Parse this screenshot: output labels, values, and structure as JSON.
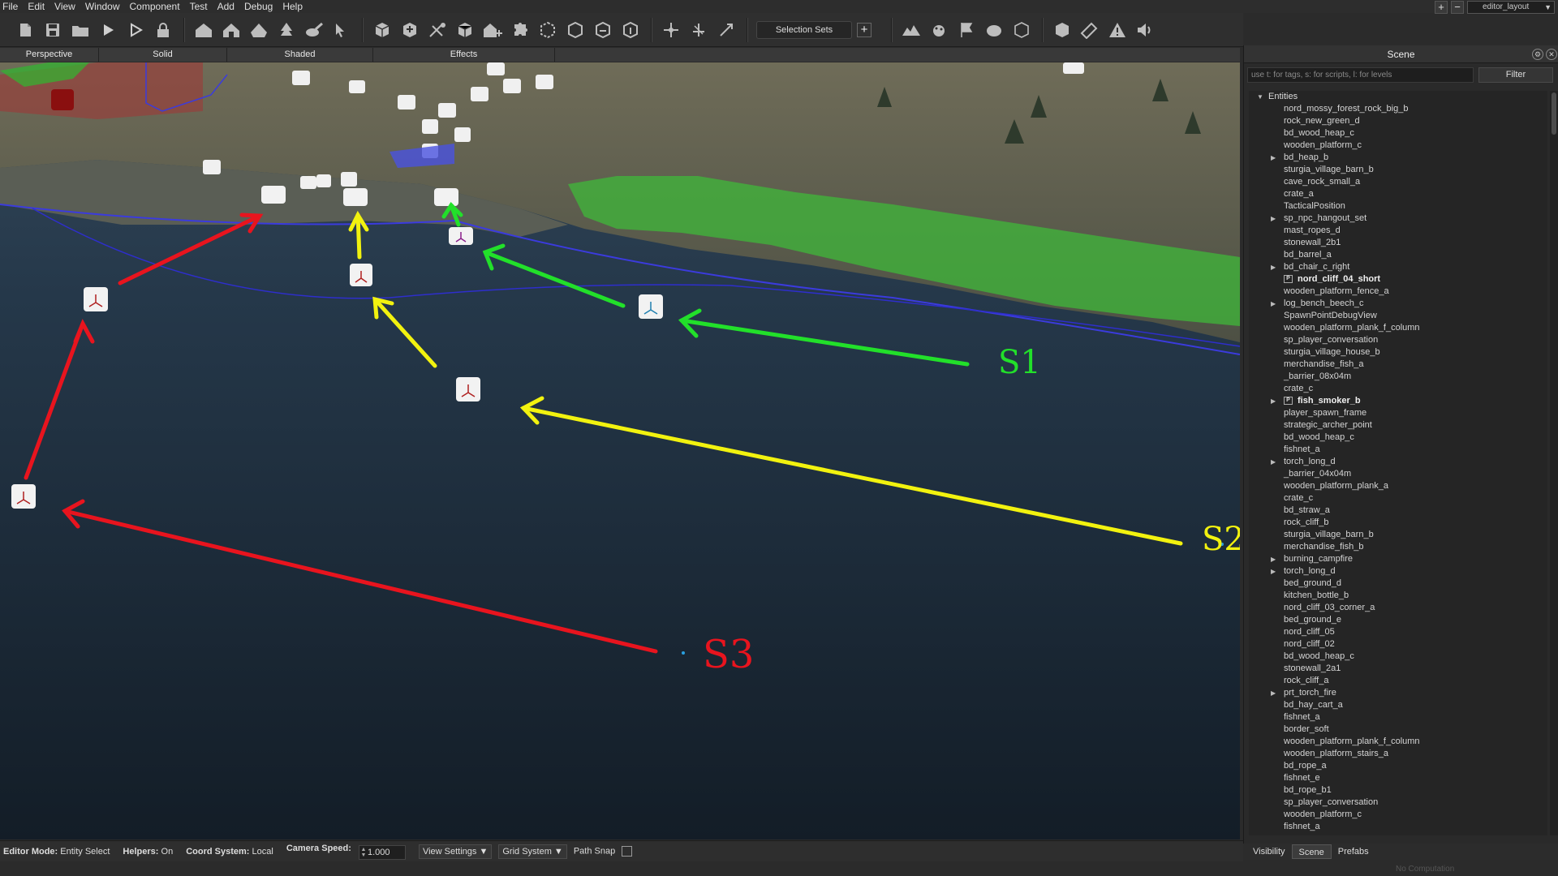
{
  "menu": [
    "File",
    "Edit",
    "View",
    "Window",
    "Component",
    "Test",
    "Add",
    "Debug",
    "Help"
  ],
  "layout": {
    "plus": "+",
    "minus": "−",
    "selected": "editor_layout"
  },
  "toolbar": {
    "selection_sets": "Selection Sets",
    "add": "+"
  },
  "viewport_tabs": [
    "Perspective",
    "Solid",
    "Shaded",
    "Effects"
  ],
  "stages": {
    "s1": {
      "label": "S1",
      "color": "#22e02a"
    },
    "s2": {
      "label": "S2",
      "color": "#f2f20f"
    },
    "s3": {
      "label": "S3",
      "color": "#e8141e"
    }
  },
  "scene_panel": {
    "title": "Scene",
    "filter_placeholder": "use t: for tags, s: for scripts, l: for levels",
    "filter_button": "Filter",
    "root": "Entities",
    "items": [
      {
        "name": "nord_mossy_forest_rock_big_b"
      },
      {
        "name": "rock_new_green_d"
      },
      {
        "name": "bd_wood_heap_c"
      },
      {
        "name": "wooden_platform_c"
      },
      {
        "name": "bd_heap_b",
        "expandable": true
      },
      {
        "name": "sturgia_village_barn_b"
      },
      {
        "name": "cave_rock_small_a"
      },
      {
        "name": "crate_a"
      },
      {
        "name": "TacticalPosition"
      },
      {
        "name": "sp_npc_hangout_set",
        "expandable": true
      },
      {
        "name": "mast_ropes_d"
      },
      {
        "name": "stonewall_2b1"
      },
      {
        "name": "bd_barrel_a"
      },
      {
        "name": "bd_chair_c_right",
        "expandable": true
      },
      {
        "name": "nord_cliff_04_short",
        "prefab": true
      },
      {
        "name": "wooden_platform_fence_a"
      },
      {
        "name": "log_bench_beech_c",
        "expandable": true
      },
      {
        "name": "SpawnPointDebugView"
      },
      {
        "name": "wooden_platform_plank_f_column"
      },
      {
        "name": "sp_player_conversation"
      },
      {
        "name": "sturgia_village_house_b"
      },
      {
        "name": "merchandise_fish_a"
      },
      {
        "name": "_barrier_08x04m"
      },
      {
        "name": "crate_c"
      },
      {
        "name": "fish_smoker_b",
        "expandable": true,
        "prefab": true
      },
      {
        "name": "player_spawn_frame"
      },
      {
        "name": "strategic_archer_point"
      },
      {
        "name": "bd_wood_heap_c"
      },
      {
        "name": "fishnet_a"
      },
      {
        "name": "torch_long_d",
        "expandable": true
      },
      {
        "name": "_barrier_04x04m"
      },
      {
        "name": "wooden_platform_plank_a"
      },
      {
        "name": "crate_c"
      },
      {
        "name": "bd_straw_a"
      },
      {
        "name": "rock_cliff_b"
      },
      {
        "name": "sturgia_village_barn_b"
      },
      {
        "name": "merchandise_fish_b"
      },
      {
        "name": "burning_campfire",
        "expandable": true
      },
      {
        "name": "torch_long_d",
        "expandable": true
      },
      {
        "name": "bed_ground_d"
      },
      {
        "name": "kitchen_bottle_b"
      },
      {
        "name": "nord_cliff_03_corner_a"
      },
      {
        "name": "bed_ground_e"
      },
      {
        "name": "nord_cliff_05"
      },
      {
        "name": "nord_cliff_02"
      },
      {
        "name": "bd_wood_heap_c"
      },
      {
        "name": "stonewall_2a1"
      },
      {
        "name": "rock_cliff_a"
      },
      {
        "name": "prt_torch_fire",
        "expandable": true
      },
      {
        "name": "bd_hay_cart_a"
      },
      {
        "name": "fishnet_a"
      },
      {
        "name": "border_soft"
      },
      {
        "name": "wooden_platform_plank_f_column"
      },
      {
        "name": "wooden_platform_stairs_a"
      },
      {
        "name": "bd_rope_a"
      },
      {
        "name": "fishnet_e"
      },
      {
        "name": "bd_rope_b1"
      },
      {
        "name": "sp_player_conversation"
      },
      {
        "name": "wooden_platform_c"
      },
      {
        "name": "fishnet_a"
      }
    ],
    "tabs": [
      "Visibility",
      "Scene",
      "Prefabs"
    ],
    "active_tab": "Scene",
    "footer": "No Computation"
  },
  "status": {
    "editor_mode_label": "Editor Mode:",
    "editor_mode_value": "Entity Select",
    "helpers_label": "Helpers:",
    "helpers_value": "On",
    "coord_label": "Coord System:",
    "coord_value": "Local",
    "camera_speed_label": "Camera Speed:",
    "camera_speed_value": "1.000",
    "view_settings": "View Settings ▼",
    "grid_system": "Grid System ▼",
    "path_snap": "Path Snap"
  }
}
